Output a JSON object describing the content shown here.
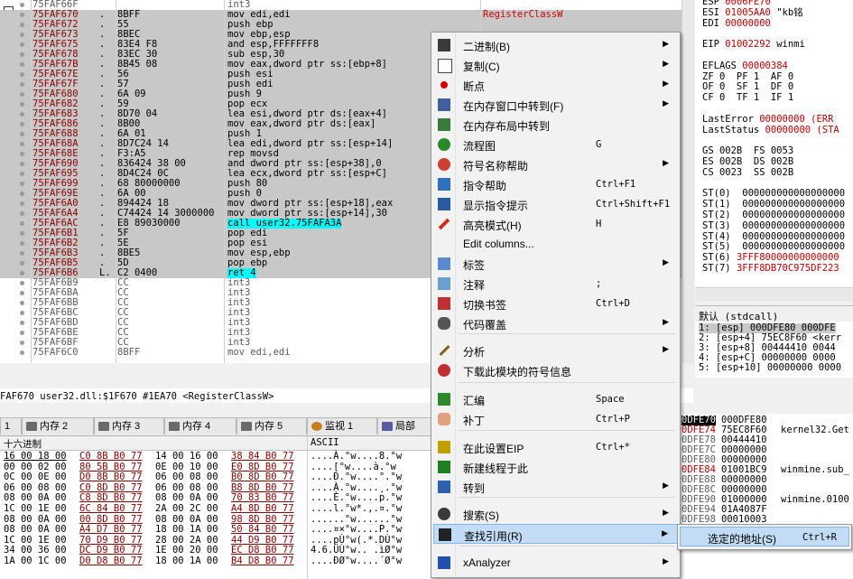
{
  "disasm": {
    "rows": [
      {
        "addr": "75FAF66F",
        "bytes": "",
        "mnem": "int3",
        "cmt": "",
        "grey": true
      },
      {
        "addr": "75FAF670",
        "mark": ".",
        "bytes": "8BFF",
        "mnem": "mov edi,edi",
        "cmt": "RegisterClassW",
        "sel": true
      },
      {
        "addr": "75FAF672",
        "mark": ".",
        "bytes": "55",
        "mnem": "push ebp",
        "sel": true,
        "push": true
      },
      {
        "addr": "75FAF673",
        "mark": ".",
        "bytes": "8BEC",
        "mnem": "mov ebp,esp",
        "sel": true
      },
      {
        "addr": "75FAF675",
        "mark": ".",
        "bytes": "83E4 F8",
        "mnem": "and esp,FFFFFFF8",
        "sel": true
      },
      {
        "addr": "75FAF678",
        "mark": ".",
        "bytes": "83EC 30",
        "mnem": "sub esp,30",
        "sel": true
      },
      {
        "addr": "75FAF67B",
        "mark": ".",
        "bytes": "8B45 08",
        "mnem": "mov eax,dword ptr ss:[ebp+8]",
        "sel": true
      },
      {
        "addr": "75FAF67E",
        "mark": ".",
        "bytes": "56",
        "mnem": "push esi",
        "sel": true,
        "push": true
      },
      {
        "addr": "75FAF67F",
        "mark": ".",
        "bytes": "57",
        "mnem": "push edi",
        "sel": true,
        "push": true
      },
      {
        "addr": "75FAF680",
        "mark": ".",
        "bytes": "6A 09",
        "mnem": "push 9",
        "sel": true,
        "push": true
      },
      {
        "addr": "75FAF682",
        "mark": ".",
        "bytes": "59",
        "mnem": "pop ecx",
        "sel": true,
        "push": true
      },
      {
        "addr": "75FAF683",
        "mark": ".",
        "bytes": "8D70 04",
        "mnem": "lea esi,dword ptr ds:[eax+4]",
        "sel": true
      },
      {
        "addr": "75FAF686",
        "mark": ".",
        "bytes": "8B00",
        "mnem": "mov eax,dword ptr ds:[eax]",
        "sel": true
      },
      {
        "addr": "75FAF688",
        "mark": ".",
        "bytes": "6A 01",
        "mnem": "push 1",
        "sel": true,
        "push": true
      },
      {
        "addr": "75FAF68A",
        "mark": ".",
        "bytes": "8D7C24 14",
        "mnem": "lea edi,dword ptr ss:[esp+14]",
        "sel": true
      },
      {
        "addr": "75FAF68E",
        "mark": ".",
        "bytes": "F3:A5",
        "mnem": "rep movsd",
        "sel": true
      },
      {
        "addr": "75FAF690",
        "mark": ".",
        "bytes": "836424 38 00",
        "mnem": "and dword ptr ss:[esp+38],0",
        "sel": true
      },
      {
        "addr": "75FAF695",
        "mark": ".",
        "bytes": "8D4C24 0C",
        "mnem": "lea ecx,dword ptr ss:[esp+C]",
        "sel": true
      },
      {
        "addr": "75FAF699",
        "mark": ".",
        "bytes": "68 80000000",
        "mnem": "push 80",
        "sel": true,
        "push": true
      },
      {
        "addr": "75FAF69E",
        "mark": ".",
        "bytes": "6A 00",
        "mnem": "push 0",
        "sel": true,
        "push": true
      },
      {
        "addr": "75FAF6A0",
        "mark": ".",
        "bytes": "894424 18",
        "mnem": "mov dword ptr ss:[esp+18],eax",
        "sel": true
      },
      {
        "addr": "75FAF6A4",
        "mark": ".",
        "bytes": "C74424 14 3000000",
        "mnem": "mov dword ptr ss:[esp+14],30",
        "sel": true
      },
      {
        "addr": "75FAF6AC",
        "mark": ".",
        "bytes": "E8 89030000",
        "mnem": "call user32.75FAFA3A",
        "sel": true,
        "call": true
      },
      {
        "addr": "75FAF6B1",
        "mark": ".",
        "bytes": "5F",
        "mnem": "pop edi",
        "sel": true,
        "push": true
      },
      {
        "addr": "75FAF6B2",
        "mark": ".",
        "bytes": "5E",
        "mnem": "pop esi",
        "sel": true,
        "push": true
      },
      {
        "addr": "75FAF6B3",
        "mark": ".",
        "bytes": "8BE5",
        "mnem": "mov esp,ebp",
        "sel": true
      },
      {
        "addr": "75FAF6B5",
        "mark": ".",
        "bytes": "5D",
        "mnem": "pop ebp",
        "sel": true,
        "push": true
      },
      {
        "addr": "75FAF6B6",
        "mark": "L.",
        "bytes": "C2 0400",
        "mnem": "ret 4",
        "sel": true,
        "ret": true
      },
      {
        "addr": "75FAF6B9",
        "bytes": "CC",
        "mnem": "int3",
        "grey": true
      },
      {
        "addr": "75FAF6BA",
        "bytes": "CC",
        "mnem": "int3",
        "grey": true
      },
      {
        "addr": "75FAF6BB",
        "bytes": "CC",
        "mnem": "int3",
        "grey": true
      },
      {
        "addr": "75FAF6BC",
        "bytes": "CC",
        "mnem": "int3",
        "grey": true
      },
      {
        "addr": "75FAF6BD",
        "bytes": "CC",
        "mnem": "int3",
        "grey": true
      },
      {
        "addr": "75FAF6BE",
        "bytes": "CC",
        "mnem": "int3",
        "grey": true
      },
      {
        "addr": "75FAF6BF",
        "bytes": "CC",
        "mnem": "int3",
        "grey": true
      },
      {
        "addr": "75FAF6C0",
        "bytes": "8BFF",
        "mnem": "mov edi,edi",
        "grey": true
      }
    ]
  },
  "registers": {
    "lines": [
      {
        "label": "ESP",
        "value": "0006FE70",
        "extra": ""
      },
      {
        "label": "ESI",
        "value": "01005AA0",
        "extra": "\"kb铭"
      },
      {
        "label": "EDI",
        "value": "00000000",
        "extra": ""
      },
      {
        "label": "",
        "value": "",
        "extra": ""
      },
      {
        "label": "EIP",
        "value": "01002292",
        "extra": "winmi"
      },
      {
        "label": "",
        "value": "",
        "extra": ""
      },
      {
        "label": "EFLAGS",
        "value": "00000384",
        "extra": ""
      },
      {
        "label": "ZF 0  PF 1  AF 0",
        "value": "",
        "extra": ""
      },
      {
        "label": "OF 0  SF 1  DF 0",
        "value": "",
        "extra": ""
      },
      {
        "label": "CF 0  TF 1  IF 1",
        "value": "",
        "extra": ""
      },
      {
        "label": "",
        "value": "",
        "extra": ""
      },
      {
        "label": "LastError",
        "value": "00000000 (ERR",
        "extra": ""
      },
      {
        "label": "LastStatus",
        "value": "00000000 (STA",
        "extra": ""
      },
      {
        "label": "",
        "value": "",
        "extra": ""
      },
      {
        "label": "GS 002B  FS 0053",
        "value": "",
        "extra": ""
      },
      {
        "label": "ES 002B  DS 002B",
        "value": "",
        "extra": ""
      },
      {
        "label": "CS 0023  SS 002B",
        "value": "",
        "extra": ""
      },
      {
        "label": "",
        "value": "",
        "extra": ""
      },
      {
        "label": "ST(0)",
        "value": "",
        "extra": "000000000000000000"
      },
      {
        "label": "ST(1)",
        "value": "",
        "extra": "000000000000000000"
      },
      {
        "label": "ST(2)",
        "value": "",
        "extra": "000000000000000000"
      },
      {
        "label": "ST(3)",
        "value": "",
        "extra": "000000000000000000"
      },
      {
        "label": "ST(4)",
        "value": "",
        "extra": "000000000000000000"
      },
      {
        "label": "ST(5)",
        "value": "",
        "extra": "000000000000000000"
      },
      {
        "label": "ST(6)",
        "value": "3FFF80000000000000",
        "extra": ""
      },
      {
        "label": "ST(7)",
        "value": "3FFF8DB70C975DF223",
        "extra": ""
      }
    ],
    "callconv_label": "默认 (stdcall)",
    "args": [
      "1: [esp] 000DFE80 000DFE",
      "2: [esp+4] 75EC8F60 <kerr",
      "3: [esp+8] 00444410 0044",
      "4: [esp+C] 00000000 0000",
      "5: [esp+10] 00000000 0000"
    ]
  },
  "infoline": "FAF670 user32.dll:$1F670 #1EA70 <RegisterClassW>",
  "tabs": [
    {
      "label": "1",
      "icon": ""
    },
    {
      "label": "内存 2",
      "icon": "memory"
    },
    {
      "label": "内存 3",
      "icon": "memory"
    },
    {
      "label": "内存 4",
      "icon": "memory"
    },
    {
      "label": "内存 5",
      "icon": "memory"
    },
    {
      "label": "监视 1",
      "icon": "watch"
    },
    {
      "label": "局部",
      "icon": "locals"
    }
  ],
  "dump": {
    "header_hex": "十六进制",
    "header_ascii": "ASCII",
    "rows": [
      {
        "hex": [
          "16 00 18 00",
          "C0 8B B0 77",
          "14 00 16 00",
          "38 84 B0 77"
        ],
        "ascii": "....À.°w....8.°w"
      },
      {
        "hex": [
          "00 00 02 00",
          "80 5B B0 77",
          "0E 00 10 00",
          "E0 8D B0 77"
        ],
        "ascii": "....[°w....à.°w"
      },
      {
        "hex": [
          "0C 00 0E 00",
          "D0 8B B0 77",
          "06 00 08 00",
          "B0 8D B0 77"
        ],
        "ascii": "....Ð.°w....°.°w"
      },
      {
        "hex": [
          "06 00 08 00",
          "C0 8D B0 77",
          "06 00 08 00",
          "B8 8D B0 77"
        ],
        "ascii": "....À.°w....¸.°w"
      },
      {
        "hex": [
          "08 00 0A 00",
          "C8 8D B0 77",
          "08 00 0A 00",
          "70 83 B0 77"
        ],
        "ascii": "....È.°w....p.°w"
      },
      {
        "hex": [
          "1C 00 1E 00",
          "6C 84 B0 77",
          "2A 00 2C 00",
          "A4 8D B0 77"
        ],
        "ascii": "....l.°w*.,.¤.°w"
      },
      {
        "hex": [
          "08 00 0A 00",
          "00 8D B0 77",
          "08 00 0A 00",
          "98 8D B0 77"
        ],
        "ascii": "......°w......°w"
      },
      {
        "hex": [
          "08 00 0A 00",
          "A4 D7 B0 77",
          "18 00 1A 00",
          "50 84 B0 77"
        ],
        "ascii": "....¤×°w....P.°w"
      },
      {
        "hex": [
          "1C 00 1E 00",
          "70 D9 B0 77",
          "28 00 2A 00",
          "44 D9 B0 77"
        ],
        "ascii": "....pÙ°w(.*.DÙ°w"
      },
      {
        "hex": [
          "34 00 36 00",
          "DC D9 B0 77",
          "1E 00 20 00",
          "EC D8 B0 77"
        ],
        "ascii": "4.6.ÜÙ°w.. .ìØ°w"
      },
      {
        "hex": [
          "1A 00 1C 00",
          "D0 D8 B0 77",
          "18 00 1A 00",
          "B4 D8 B0 77"
        ],
        "ascii": "....ÐØ°w....´Ø°w"
      }
    ]
  },
  "stack": {
    "rows": [
      {
        "a": "0DFE70",
        "v": "000DFE80",
        "c": "",
        "hi": true
      },
      {
        "a": "0DFE74",
        "v": "75EC8F60",
        "c": "kernel32.Get",
        "red": true
      },
      {
        "a": "0DFE78",
        "v": "00444410",
        "c": ""
      },
      {
        "a": "0DFE7C",
        "v": "00000000",
        "c": ""
      },
      {
        "a": "0DFE80",
        "v": "00000000",
        "c": ""
      },
      {
        "a": "0DFE84",
        "v": "01001BC9",
        "c": "winmine.sub_",
        "red": true
      },
      {
        "a": "0DFE88",
        "v": "00000000",
        "c": ""
      },
      {
        "a": "0DFE8C",
        "v": "00000000",
        "c": ""
      },
      {
        "a": "0DFE90",
        "v": "01000000",
        "c": "winmine.0100"
      },
      {
        "a": "0DFE94",
        "v": "01A4087F",
        "c": ""
      },
      {
        "a": "0DFE98",
        "v": "00010003",
        "c": ""
      }
    ]
  },
  "menu": {
    "items": [
      {
        "id": "binary",
        "label": "二进制(B)",
        "shortcut": "",
        "sub": true,
        "icon": "binary"
      },
      {
        "id": "copy",
        "label": "复制(C)",
        "shortcut": "",
        "sub": true,
        "icon": "copy"
      },
      {
        "id": "breakpoint",
        "label": "断点",
        "shortcut": "",
        "sub": true,
        "icon": "breakpoint"
      },
      {
        "id": "goto-mem",
        "label": "在内存窗口中转到(F)",
        "shortcut": "",
        "sub": true,
        "icon": "memwin"
      },
      {
        "id": "goto-layout",
        "label": "在内存布局中转到",
        "shortcut": "",
        "sub": false,
        "icon": "memmap"
      },
      {
        "id": "graph",
        "label": "流程图",
        "shortcut": "G",
        "sub": false,
        "icon": "graph"
      },
      {
        "id": "symhelp",
        "label": "符号名称帮助",
        "shortcut": "",
        "sub": true,
        "icon": "lifebuoy"
      },
      {
        "id": "insthelp",
        "label": "指令帮助",
        "shortcut": "Ctrl+F1",
        "sub": false,
        "icon": "question"
      },
      {
        "id": "insttip",
        "label": "显示指令提示",
        "shortcut": "Ctrl+Shift+F1",
        "sub": false,
        "icon": "info"
      },
      {
        "id": "highlight",
        "label": "高亮模式(H)",
        "shortcut": "H",
        "sub": false,
        "icon": "pen"
      },
      {
        "id": "editcols",
        "label": "Edit columns...",
        "shortcut": "",
        "sub": false,
        "icon": ""
      },
      {
        "id": "label",
        "label": "标签",
        "shortcut": "",
        "sub": true,
        "icon": "tag"
      },
      {
        "id": "comment",
        "label": "注释",
        "shortcut": ";",
        "sub": false,
        "icon": "comment"
      },
      {
        "id": "bookmark",
        "label": "切换书签",
        "shortcut": "Ctrl+D",
        "sub": false,
        "icon": "bookmark"
      },
      {
        "id": "coverage",
        "label": "代码覆盖",
        "shortcut": "",
        "sub": true,
        "icon": "footprint"
      },
      {
        "id": "analyze",
        "label": "分析",
        "shortcut": "",
        "sub": true,
        "icon": "wand"
      },
      {
        "id": "dlsym",
        "label": "下载此模块的符号信息",
        "shortcut": "",
        "sub": false,
        "icon": "download"
      },
      {
        "id": "assemble",
        "label": "汇编",
        "shortcut": "Space",
        "sub": false,
        "icon": "asm"
      },
      {
        "id": "patch",
        "label": "补丁",
        "shortcut": "Ctrl+P",
        "sub": false,
        "icon": "bandage"
      },
      {
        "id": "seteip",
        "label": "在此设置EIP",
        "shortcut": "Ctrl+*",
        "sub": false,
        "icon": "star"
      },
      {
        "id": "newthread",
        "label": "新建线程于此",
        "shortcut": "",
        "sub": false,
        "icon": "thread"
      },
      {
        "id": "goto",
        "label": "转到",
        "shortcut": "",
        "sub": true,
        "icon": "car"
      },
      {
        "id": "search",
        "label": "搜索(S)",
        "shortcut": "",
        "sub": true,
        "icon": "search"
      },
      {
        "id": "xref",
        "label": "查找引用(R)",
        "shortcut": "",
        "sub": true,
        "icon": "binoculars",
        "active": true
      },
      {
        "id": "xanalyzer",
        "label": "xAnalyzer",
        "shortcut": "",
        "sub": true,
        "icon": "xanalyzer"
      }
    ],
    "submenu": {
      "label": "选定的地址(S)",
      "shortcut": "Ctrl+R"
    }
  }
}
